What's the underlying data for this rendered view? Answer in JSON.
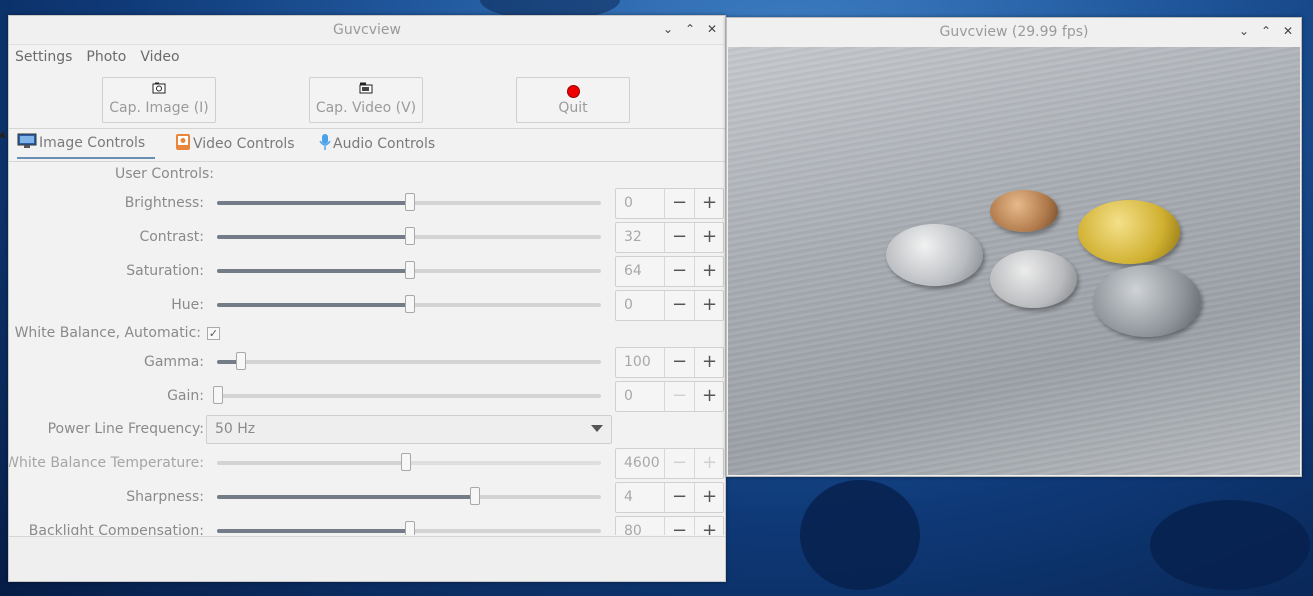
{
  "main_window": {
    "title": "Guvcview",
    "menu": [
      "Settings",
      "Photo",
      "Video"
    ],
    "toolbar": {
      "cap_image": "Cap. Image (I)",
      "cap_video": "Cap. Video (V)",
      "quit": "Quit"
    },
    "tabs": [
      "Image Controls",
      "Video Controls",
      "Audio Controls"
    ],
    "section": "User Controls:",
    "controls": {
      "brightness": {
        "label": "Brightness:",
        "value": "0",
        "level": 0.5
      },
      "contrast": {
        "label": "Contrast:",
        "value": "32",
        "level": 0.5
      },
      "saturation": {
        "label": "Saturation:",
        "value": "64",
        "level": 0.5
      },
      "hue": {
        "label": "Hue:",
        "value": "0",
        "level": 0.5
      },
      "wb_auto": {
        "label": "White Balance, Automatic:",
        "checked": true
      },
      "gamma": {
        "label": "Gamma:",
        "value": "100",
        "level": 0.06
      },
      "gain": {
        "label": "Gain:",
        "value": "0",
        "level": 0.0
      },
      "power_line": {
        "label": "Power Line Frequency:",
        "value": "50 Hz"
      },
      "wb_temp": {
        "label": "White Balance Temperature:",
        "value": "4600",
        "level": 0.49
      },
      "sharpness": {
        "label": "Sharpness:",
        "value": "4",
        "level": 0.67
      },
      "backlight": {
        "label": "Backlight Compensation:",
        "value": "80",
        "level": 0.5
      }
    }
  },
  "preview_window": {
    "title": "Guvcview  (29.99 fps)"
  },
  "icons": {
    "camera": "camera-icon",
    "video": "video-camera-icon",
    "record": "record-icon",
    "monitor": "monitor-icon",
    "film": "film-icon",
    "mic": "microphone-icon"
  }
}
